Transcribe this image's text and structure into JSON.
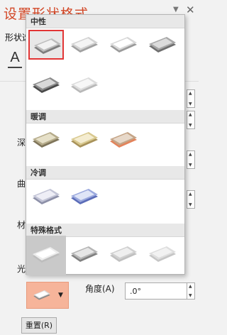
{
  "pane": {
    "title": "设置形状格式",
    "tab_shape": "形状选项",
    "labels": {
      "depth": "深",
      "contour": "曲",
      "material": "材",
      "lighting": "光"
    },
    "angle_label": "角度(A)",
    "angle_value": ".0°",
    "reset_label": "重置(R)"
  },
  "gallery": {
    "sections": [
      {
        "title": "中性",
        "items": [
          {
            "name": "neutral-1",
            "selected": true,
            "top": "#f2f2f2",
            "mid": "#bdbdbd",
            "side": "#7d7d7d"
          },
          {
            "name": "neutral-2",
            "top": "#f4f4f4",
            "mid": "#d2d2d2",
            "side": "#a0a0a0"
          },
          {
            "name": "neutral-3",
            "top": "#ffffff",
            "mid": "#d7d7d7",
            "side": "#9a9a9a"
          },
          {
            "name": "neutral-4",
            "top": "#dcdcdc",
            "mid": "#a7a7a7",
            "side": "#6e6e6e"
          },
          {
            "name": "neutral-5",
            "top": "#d9d9d9",
            "mid": "#8c8c8c",
            "side": "#4a4a4a"
          },
          {
            "name": "neutral-6",
            "top": "#f7f7f7",
            "mid": "#dcdcdc",
            "side": "#b8b8b8"
          }
        ]
      },
      {
        "title": "暖调",
        "items": [
          {
            "name": "warm-1",
            "top": "#e6e0c8",
            "mid": "#b5ab8a",
            "side": "#7f755a"
          },
          {
            "name": "warm-2",
            "top": "#f4ecd0",
            "mid": "#d8c88e",
            "side": "#a8925a"
          },
          {
            "name": "warm-3",
            "top": "#e7d8c9",
            "mid": "#c4a486",
            "side": "#e3835b"
          }
        ]
      },
      {
        "title": "冷调",
        "items": [
          {
            "name": "cool-1",
            "top": "#eeeef6",
            "mid": "#c2c4d6",
            "side": "#8d90a8"
          },
          {
            "name": "cool-2",
            "top": "#dfe5f7",
            "mid": "#9aa8dd",
            "side": "#5b6cb8"
          }
        ]
      },
      {
        "title": "特殊格式",
        "items": [
          {
            "name": "special-1",
            "hovered": true,
            "top": "#ffffff",
            "mid": "#ececec",
            "side": "#bdbdbd"
          },
          {
            "name": "special-2",
            "top": "#e6e6e6",
            "mid": "#b5b5b5",
            "side": "#808080"
          },
          {
            "name": "special-3",
            "top": "#efefef",
            "mid": "#d0d0d0",
            "side": "#c0c0c0"
          },
          {
            "name": "special-4",
            "top": "#f2f2f2",
            "mid": "#dedede",
            "side": "#c6c6c6"
          }
        ]
      }
    ]
  },
  "colors": {
    "accent": "#d24726",
    "selection": "#e23535",
    "preset_button": "#f6b49a"
  }
}
